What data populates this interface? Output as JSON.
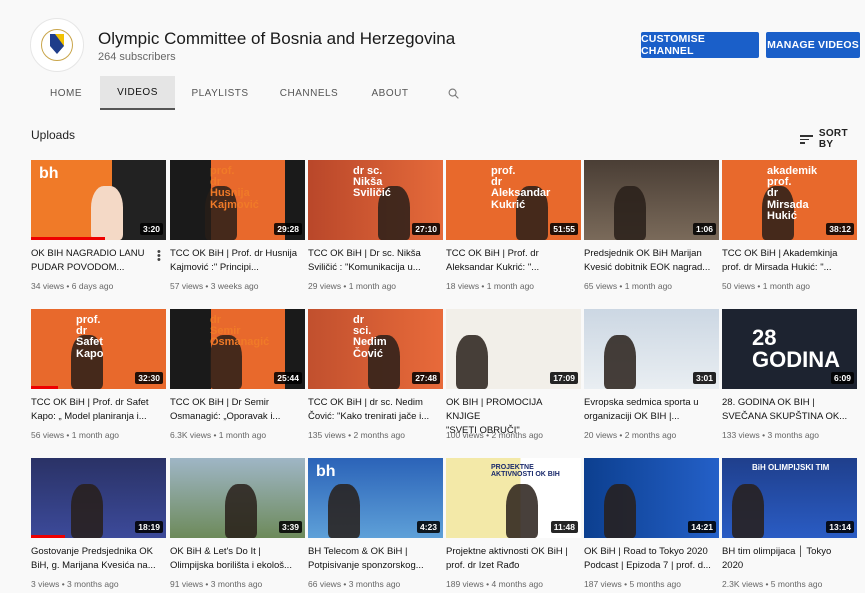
{
  "channel": {
    "name": "Olympic Committee of Bosnia and Herzegovina",
    "subscribers": "264 subscribers"
  },
  "buttons": {
    "customise": "CUSTOMISE CHANNEL",
    "manage": "MANAGE VIDEOS"
  },
  "tabs": [
    "HOME",
    "VIDEOS",
    "PLAYLISTS",
    "CHANNELS",
    "ABOUT"
  ],
  "section": {
    "title": "Uploads",
    "sort": "SORT BY"
  },
  "icons": {
    "search": "search-icon",
    "sort": "sort-icon",
    "more": "more-vert-icon"
  },
  "videos": [
    {
      "t1": "OK BIH NAGRADIO LANU",
      "t2": "PUDAR POVODOM...",
      "meta": "34 views • 6 days ago",
      "dur": "3:20",
      "overlay": [
        "bh"
      ]
    },
    {
      "t1": "TCC OK BiH | Prof. dr Husnija",
      "t2": "Kajmović :\" Principi...",
      "meta": "57 views • 3 weeks ago",
      "dur": "29:28",
      "overlay": [
        "prof.",
        "dr",
        "Husnija",
        "Kajmović"
      ]
    },
    {
      "t1": "TCC OK BiH | Dr sc. Nikša",
      "t2": "Sviličić : \"Komunikacija u...",
      "meta": "29 views • 1 month ago",
      "dur": "27:10",
      "overlay": [
        "dr sc.",
        "Nikša",
        "Sviličić"
      ]
    },
    {
      "t1": "TCC OK BiH | Prof. dr",
      "t2": "Aleksandar Kukrić: \"...",
      "meta": "18 views • 1 month ago",
      "dur": "51:55",
      "overlay": [
        "prof.",
        "dr",
        "Aleksandar",
        "Kukrić"
      ]
    },
    {
      "t1": "Predsjednik OK BiH Marijan",
      "t2": "Kvesić dobitnik EOK nagrad...",
      "meta": "65 views • 1 month ago",
      "dur": "1:06",
      "overlay": []
    },
    {
      "t1": "TCC OK BiH | Akademkinja",
      "t2": "prof. dr Mirsada Hukić: \"...",
      "meta": "50 views • 1 month ago",
      "dur": "38:12",
      "overlay": [
        "akademik",
        "prof.",
        "dr",
        "Mirsada",
        "Hukić"
      ]
    },
    {
      "t1": "TCC OK BiH | Prof. dr Safet",
      "t2": "Kapo: „ Model planiranja i...",
      "meta": "56 views • 1 month ago",
      "dur": "32:30",
      "overlay": [
        "prof.",
        "dr",
        "Safet",
        "Kapo"
      ]
    },
    {
      "t1": "TCC OK BiH | Dr Semir",
      "t2": "Osmanagić: „Oporavak i...",
      "meta": "6.3K views • 1 month ago",
      "dur": "25:44",
      "overlay": [
        "dr",
        "Semir",
        "Osmanagić"
      ]
    },
    {
      "t1": "TCC OK BiH | dr sc. Nedim",
      "t2": "Čović: \"Kako trenirati jače i...",
      "meta": "135 views • 2 months ago",
      "dur": "27:48",
      "overlay": [
        "dr",
        "sci.",
        "Nedim",
        "Čović"
      ]
    },
    {
      "t1": "OK BIH | PROMOCIJA KNJIGE",
      "t2": "\"SVETI OBRUČI\"",
      "meta": "100 views • 2 months ago",
      "dur": "17:09",
      "overlay": []
    },
    {
      "t1": "Evropska sedmica sporta u",
      "t2": "organizaciji OK BIH |...",
      "meta": "20 views • 2 months ago",
      "dur": "3:01",
      "overlay": []
    },
    {
      "t1": "28. GODINA OK BIH |",
      "t2": "SVEČANA SKUPŠTINA OK...",
      "meta": "133 views • 3 months ago",
      "dur": "6:09",
      "overlay": [
        "28",
        "GODINA"
      ]
    },
    {
      "t1": "Gostovanje Predsjednika OK",
      "t2": "BiH, g. Marijana Kvesića na...",
      "meta": "3 views • 3 months ago",
      "dur": "18:19",
      "overlay": []
    },
    {
      "t1": "OK BiH & Let's Do It |",
      "t2": "Olimpijska borilišta i ekološ...",
      "meta": "91 views • 3 months ago",
      "dur": "3:39",
      "overlay": []
    },
    {
      "t1": "BH Telecom & OK BiH |",
      "t2": "Potpisivanje sponzorskog...",
      "meta": "66 views • 3 months ago",
      "dur": "4:23",
      "overlay": [
        "bh"
      ]
    },
    {
      "t1": "Projektne aktivnosti OK BiH |",
      "t2": "prof. dr Izet Rađo",
      "meta": "189 views • 4 months ago",
      "dur": "11:48",
      "overlay": [
        "PROJEKTNE",
        "AKTIVNOSTI OK BIH"
      ]
    },
    {
      "t1": "OK BiH | Road to Tokyo 2020",
      "t2": "Podcast | Epizoda 7 | prof. d...",
      "meta": "187 views • 5 months ago",
      "dur": "14:21",
      "overlay": []
    },
    {
      "t1": "BH tim olimpijaca │ Tokyo",
      "t2": "2020",
      "meta": "2.3K views • 5 months ago",
      "dur": "13:14",
      "overlay": [
        "BiH OLIMPIJSKI TIM"
      ]
    }
  ]
}
